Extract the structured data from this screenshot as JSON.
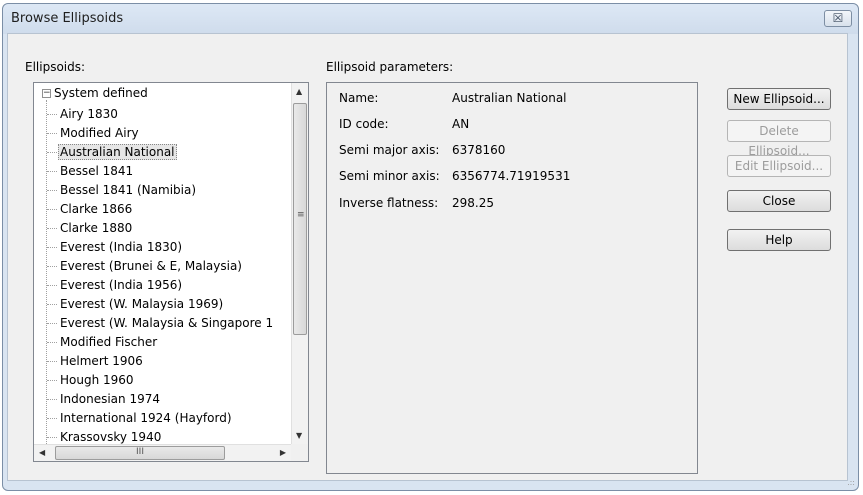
{
  "window": {
    "title": "Browse Ellipsoids",
    "close_symbol": "☒"
  },
  "ellipsoids": {
    "label": "Ellipsoids:",
    "root": {
      "label": "System defined",
      "expander": "−"
    },
    "items": [
      "Airy 1830",
      "Modified Airy",
      "Australian National",
      "Bessel 1841",
      "Bessel 1841 (Namibia)",
      "Clarke 1866",
      "Clarke 1880",
      "Everest (India 1830)",
      "Everest (Brunei & E, Malaysia)",
      "Everest (India 1956)",
      "Everest (W. Malaysia 1969)",
      "Everest (W. Malaysia & Singapore 1",
      "Modified Fischer",
      "Helmert 1906",
      "Hough 1960",
      "Indonesian 1974",
      "International 1924 (Hayford)",
      "Krassovsky 1940"
    ],
    "selected": "Australian National",
    "scroll": {
      "up": "▲",
      "down": "▼",
      "left": "◀",
      "right": "▶",
      "grip_v": "≡",
      "grip_h": "III"
    }
  },
  "parameters": {
    "label": "Ellipsoid parameters:",
    "rows": [
      {
        "label": "Name:",
        "value": "Australian National"
      },
      {
        "label": "ID code:",
        "value": "AN"
      },
      {
        "label": "Semi major axis:",
        "value": "6378160"
      },
      {
        "label": "Semi minor axis:",
        "value": "6356774.71919531"
      },
      {
        "label": "Inverse flatness:",
        "value": "298.25"
      }
    ]
  },
  "buttons": {
    "new": "New Ellipsoid...",
    "delete": "Delete Ellipsoid...",
    "edit": "Edit Ellipsoid...",
    "close": "Close",
    "help": "Help"
  }
}
